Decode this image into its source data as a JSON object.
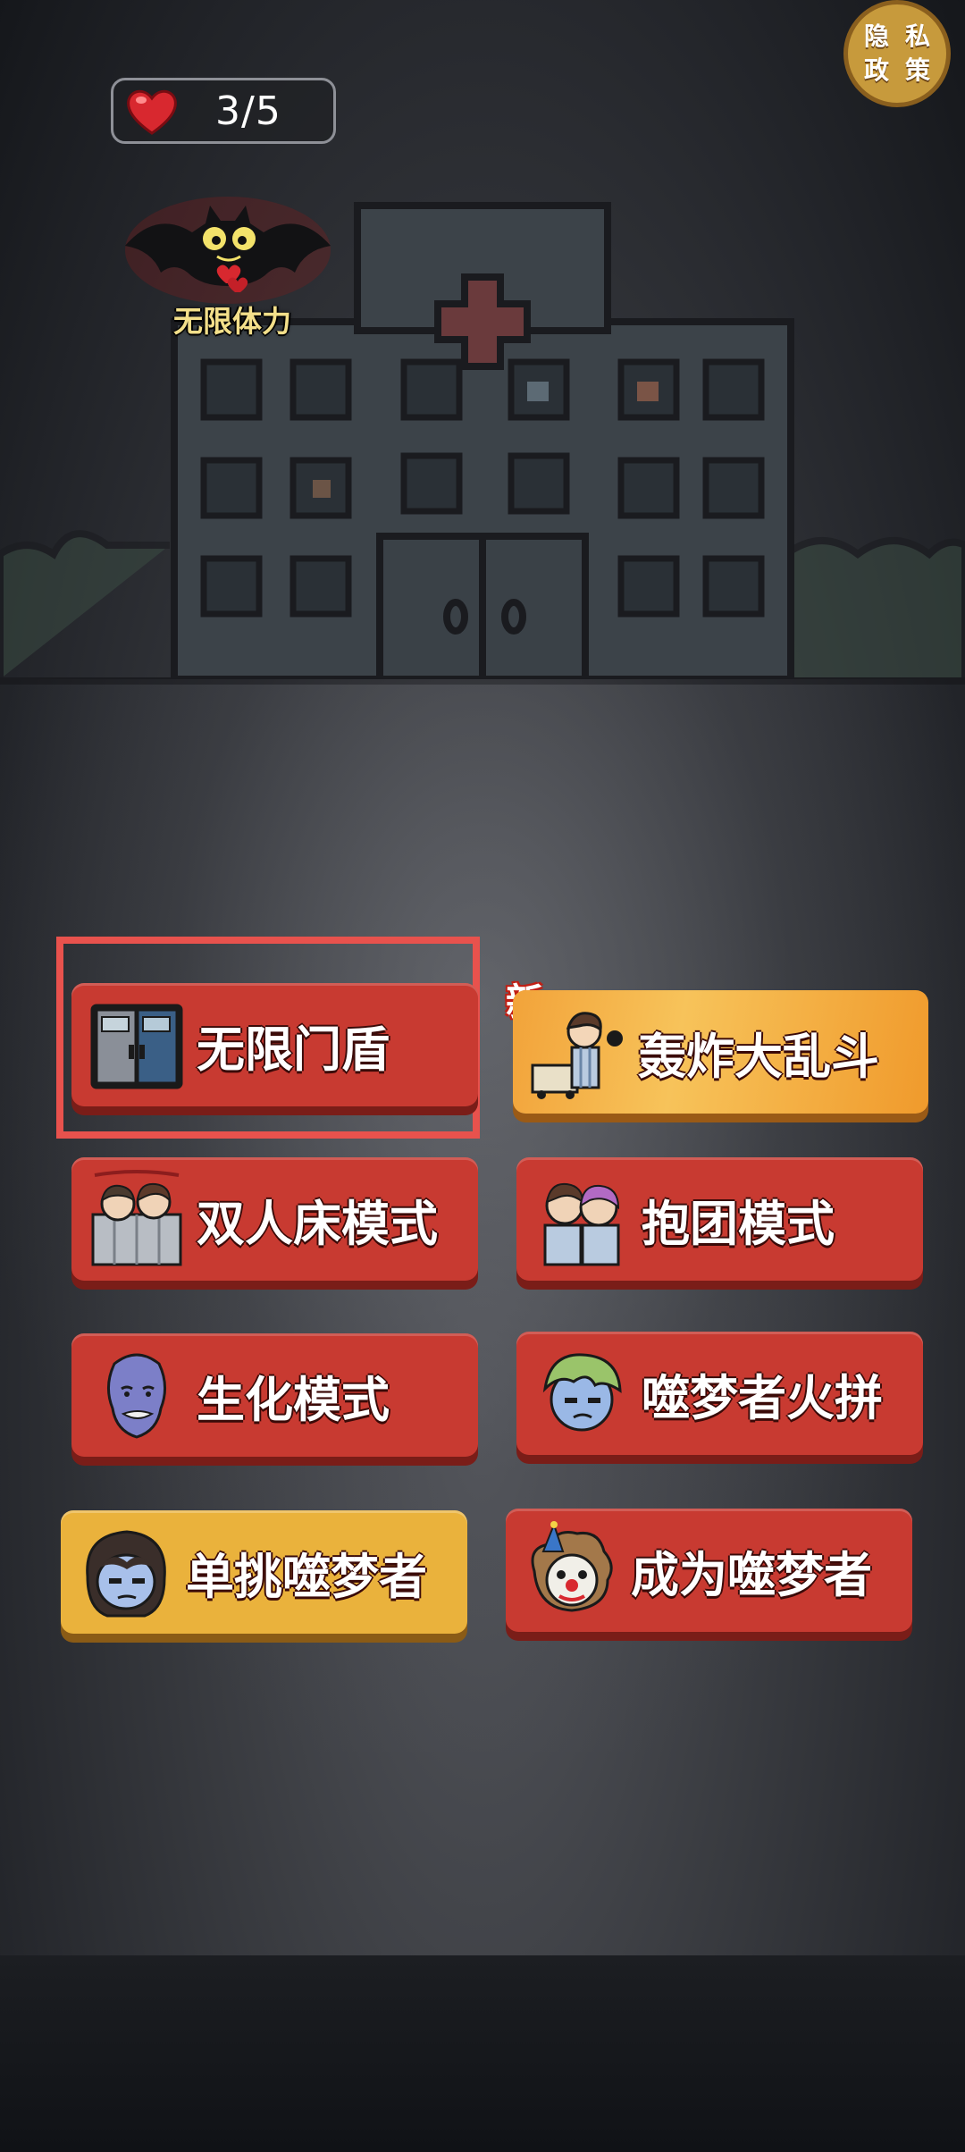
{
  "hud": {
    "hearts_count": "3/5",
    "privacy_chars": [
      "隐",
      "私",
      "政",
      "策"
    ]
  },
  "promo": {
    "label": "无限体力"
  },
  "modes": [
    {
      "label": "无限门盾",
      "icon": "door-icon",
      "color": "red"
    },
    {
      "label": "轰炸大乱斗",
      "icon": "bomb-patients-icon",
      "color": "orange",
      "badge": "新"
    },
    {
      "label": "双人床模式",
      "icon": "double-bed-icon",
      "color": "red"
    },
    {
      "label": "抱团模式",
      "icon": "group-hug-icon",
      "color": "red"
    },
    {
      "label": "生化模式",
      "icon": "zombie-face-icon",
      "color": "red"
    },
    {
      "label": "噬梦者火拼",
      "icon": "green-hair-face-icon",
      "color": "red"
    },
    {
      "label": "单挑噬梦者",
      "icon": "dark-hair-face-icon",
      "color": "yellow"
    },
    {
      "label": "成为噬梦者",
      "icon": "clown-face-icon",
      "color": "red"
    }
  ],
  "colors": {
    "button_red": "#c83a31",
    "button_yellow": "#eab23c",
    "button_orange": "#f2a33a",
    "highlight": "#e8524d"
  }
}
